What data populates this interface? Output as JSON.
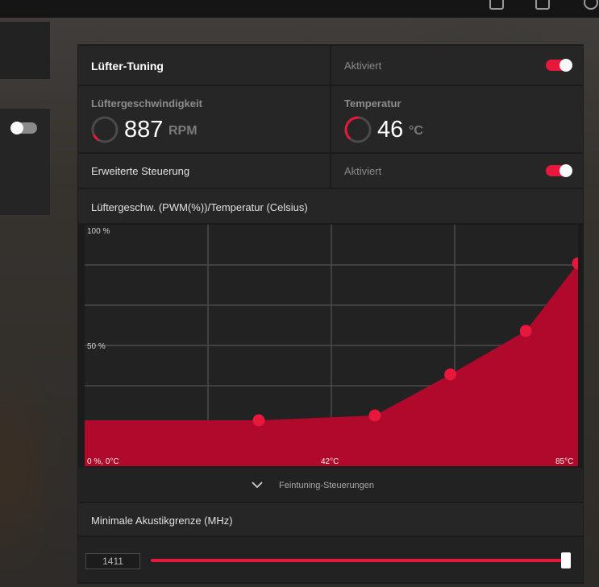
{
  "fan_tuning": {
    "title": "Lüfter-Tuning",
    "status": "Aktiviert",
    "enabled": true
  },
  "fan_speed": {
    "title": "Lüftergeschwindigkeit",
    "value": "887",
    "unit": "RPM"
  },
  "temperature": {
    "title": "Temperatur",
    "value": "46",
    "unit": "°C"
  },
  "advanced_control": {
    "label": "Erweiterte Steuerung",
    "status": "Aktiviert",
    "enabled": true
  },
  "curve_header": "Lüftergeschw. (PWM(%))/Temperatur (Celsius)",
  "chart_data": {
    "type": "area",
    "y_tick_labels": [
      "100 %",
      "50 %",
      "0 %, 0°C"
    ],
    "x_tick_labels": [
      "42°C",
      "85°C"
    ],
    "xlim": [
      0,
      85
    ],
    "ylim": [
      0,
      100
    ],
    "points": [
      {
        "x": 30,
        "y": 19
      },
      {
        "x": 50,
        "y": 21
      },
      {
        "x": 63,
        "y": 38
      },
      {
        "x": 76,
        "y": 56
      },
      {
        "x": 85,
        "y": 84
      }
    ],
    "line_start_y": 19,
    "fill_color": "#b0092c",
    "point_color": "#e8173c",
    "grid": true
  },
  "fine_tuning": {
    "label": "Feintuning-Steuerungen"
  },
  "acoustic_limit": {
    "label": "Minimale Akustikgrenze (MHz)",
    "value": "1411",
    "level_fraction": 1.0
  },
  "accent_color": "#e8173c"
}
